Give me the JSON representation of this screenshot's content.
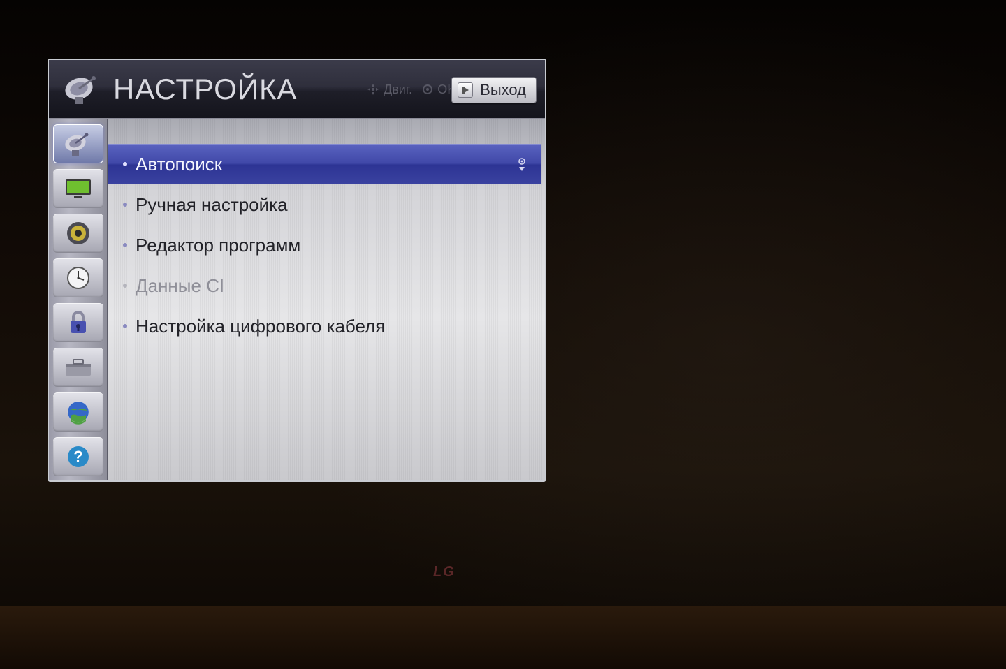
{
  "brand_logo": "LG",
  "header": {
    "title": "НАСТРОЙКА",
    "move_hint": "Двиг.",
    "ok_hint": "OK",
    "exit_label": "Выход",
    "exit_key": "⏎"
  },
  "sidebar": {
    "items": [
      {
        "name": "setup",
        "icon": "dish-icon",
        "active": true
      },
      {
        "name": "picture",
        "icon": "monitor-icon",
        "active": false
      },
      {
        "name": "audio",
        "icon": "speaker-icon",
        "active": false
      },
      {
        "name": "time",
        "icon": "clock-icon",
        "active": false
      },
      {
        "name": "lock",
        "icon": "lock-icon",
        "active": false
      },
      {
        "name": "option",
        "icon": "toolbox-icon",
        "active": false
      },
      {
        "name": "network",
        "icon": "globe-icon",
        "active": false
      },
      {
        "name": "support",
        "icon": "help-icon",
        "active": false
      }
    ]
  },
  "menu": {
    "items": [
      {
        "label": "Автопоиск",
        "selected": true,
        "disabled": false
      },
      {
        "label": "Ручная настройка",
        "selected": false,
        "disabled": false
      },
      {
        "label": "Редактор программ",
        "selected": false,
        "disabled": false
      },
      {
        "label": "Данные CI",
        "selected": false,
        "disabled": true
      },
      {
        "label": "Настройка цифрового кабеля",
        "selected": false,
        "disabled": false
      }
    ]
  }
}
